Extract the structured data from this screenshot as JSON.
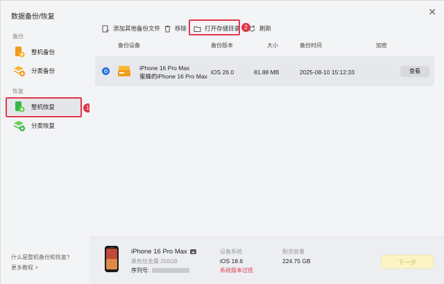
{
  "window": {
    "title": "数据备份/恢复"
  },
  "sidebar": {
    "backup_section": "备份",
    "restore_section": "恢复",
    "items": [
      {
        "label": "整机备份",
        "icon": "phone-backup-icon"
      },
      {
        "label": "分类备份",
        "icon": "category-backup-icon"
      },
      {
        "label": "整机恢复",
        "icon": "phone-restore-icon"
      },
      {
        "label": "分类恢复",
        "icon": "category-restore-icon"
      }
    ],
    "footer_question": "什么是整机备份和恢复?",
    "footer_more": "更多教程 >"
  },
  "annotations": {
    "marker1": "1",
    "marker2": "2"
  },
  "toolbar": {
    "add_label": "添加其他备份文件",
    "remove_label": "移除",
    "open_dir_label": "打开存储目录",
    "refresh_label": "刷新"
  },
  "table": {
    "headers": [
      "备份设备",
      "备份版本",
      "大小",
      "备份时间",
      "加密"
    ],
    "rows": [
      {
        "device": "iPhone 16 Pro Max",
        "owner": "蜜蜂的iPhone 16 Pro Max",
        "version": "iOS 26.0",
        "size": "81.88 MB",
        "time": "2025-08-10 15:12:33",
        "action": "查看"
      }
    ]
  },
  "bottom": {
    "device_name": "iPhone 16 Pro Max",
    "device_color": "黑色钛金属 256GB",
    "serial_label": "序列号:",
    "system_label": "设备系统",
    "system_value": "iOS 18.6",
    "system_warning": "系统版本过低",
    "space_label": "剩余容量",
    "space_value": "224.75 GB",
    "next_label": "下一步"
  },
  "colors": {
    "accent": "#1f6fe0",
    "highlight": "#e0384b",
    "icon_orange": "#f29b1d",
    "icon_green": "#39b54a"
  }
}
